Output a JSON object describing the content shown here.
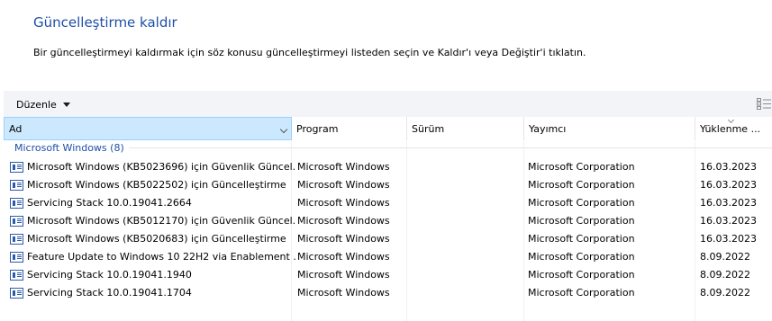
{
  "page": {
    "title": "Güncelleştirme kaldır",
    "subtitle": "Bir güncelleştirmeyi kaldırmak için söz konusu güncelleştirmeyi listeden seçin ve Kaldır'ı veya Değiştir'i tıklatın."
  },
  "toolbar": {
    "organize_label": "Düzenle",
    "view_icon": "view-options-icon"
  },
  "columns": [
    "Ad",
    "Program",
    "Sürüm",
    "Yayımcı",
    "Yüklenme ..."
  ],
  "group": {
    "label": "Microsoft Windows (8)"
  },
  "rows": [
    {
      "name": "Microsoft Windows (KB5023696) için Güvenlik Güncel...",
      "program": "Microsoft Windows",
      "version": "",
      "publisher": "Microsoft Corporation",
      "date": "16.03.2023"
    },
    {
      "name": "Microsoft Windows (KB5022502) için Güncelleştirme",
      "program": "Microsoft Windows",
      "version": "",
      "publisher": "Microsoft Corporation",
      "date": "16.03.2023"
    },
    {
      "name": "Servicing Stack 10.0.19041.2664",
      "program": "Microsoft Windows",
      "version": "",
      "publisher": "Microsoft Corporation",
      "date": "16.03.2023"
    },
    {
      "name": "Microsoft Windows (KB5012170) için Güvenlik Güncel...",
      "program": "Microsoft Windows",
      "version": "",
      "publisher": "Microsoft Corporation",
      "date": "16.03.2023"
    },
    {
      "name": "Microsoft Windows (KB5020683) için Güncelleştirme",
      "program": "Microsoft Windows",
      "version": "",
      "publisher": "Microsoft Corporation",
      "date": "16.03.2023"
    },
    {
      "name": "Feature Update to Windows 10 22H2 via Enablement ...",
      "program": "Microsoft Windows",
      "version": "",
      "publisher": "Microsoft Corporation",
      "date": "8.09.2022"
    },
    {
      "name": "Servicing Stack 10.0.19041.1940",
      "program": "Microsoft Windows",
      "version": "",
      "publisher": "Microsoft Corporation",
      "date": "8.09.2022"
    },
    {
      "name": "Servicing Stack 10.0.19041.1704",
      "program": "Microsoft Windows",
      "version": "",
      "publisher": "Microsoft Corporation",
      "date": "8.09.2022"
    }
  ],
  "colors": {
    "accent": "#1e4fa8",
    "toolbar_bg": "#f2f4f7",
    "selected_header": "#cce8ff"
  }
}
